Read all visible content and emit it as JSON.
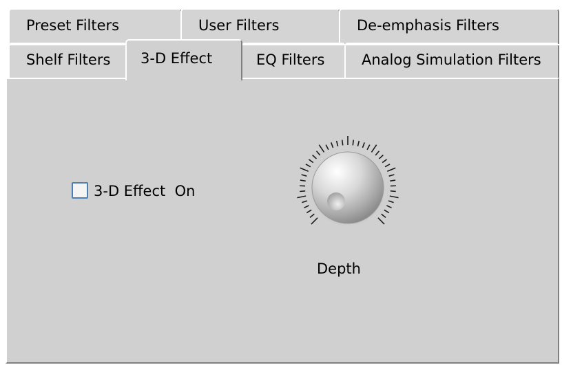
{
  "tabs": {
    "row1": [
      "Preset Filters",
      "User Filters",
      "De-emphasis Filters"
    ],
    "row2": [
      "Shelf Filters",
      "3-D Effect",
      "EQ Filters",
      "Analog Simulation Filters"
    ],
    "active": "3-D Effect"
  },
  "panel": {
    "checkbox_label": "3-D Effect  On",
    "checkbox_checked": false,
    "knob_label": "Depth"
  }
}
